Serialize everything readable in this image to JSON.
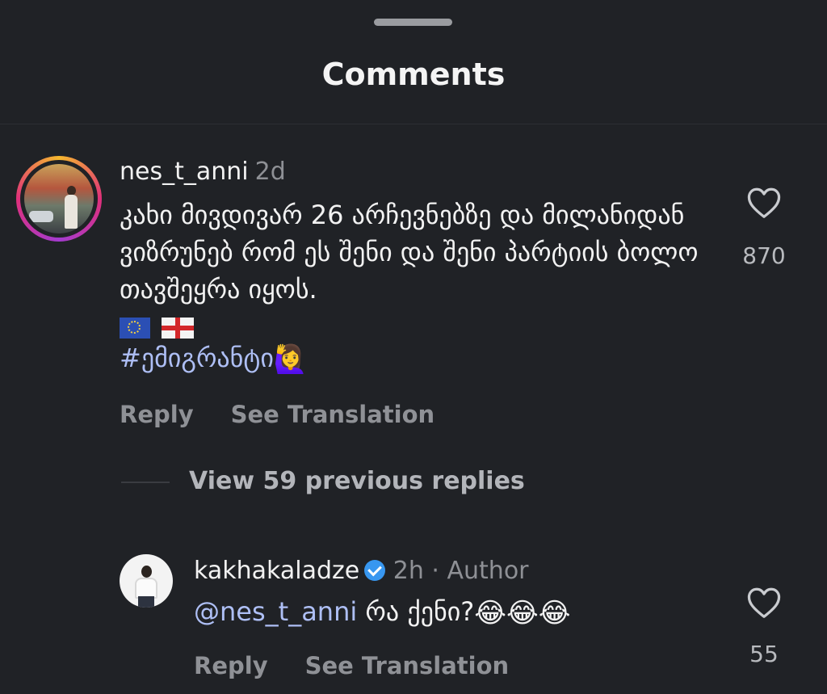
{
  "sheet": {
    "title": "Comments"
  },
  "comment": {
    "username": "nes_t_anni",
    "time": "2d",
    "text": "კახი მივდივარ 26 არჩევნებზე და მილანიდან ვიზრუნებ რომ ეს შენი და შენი პარტიის ბოლო თავშეყრა იყოს.",
    "flags": [
      "eu-flag-icon",
      "georgia-flag-icon"
    ],
    "hashtag": "#ემიგრანტი",
    "hashtag_emoji": "🙋‍♀️",
    "likes": "870",
    "reply_label": "Reply",
    "translate_label": "See Translation"
  },
  "view_replies_label": "View 59 previous replies",
  "reply": {
    "username": "kakhakaladze",
    "verified": true,
    "time": "2h",
    "separator": "·",
    "author_label": "Author",
    "mention": "@nes_t_anni",
    "text": "რა ქენი?",
    "emojis": "😂😂😂",
    "likes": "55",
    "reply_label": "Reply",
    "translate_label": "See Translation"
  },
  "colors": {
    "background": "#202226",
    "link": "#aebff5",
    "muted": "#8f9196",
    "verified": "#3897f0"
  }
}
